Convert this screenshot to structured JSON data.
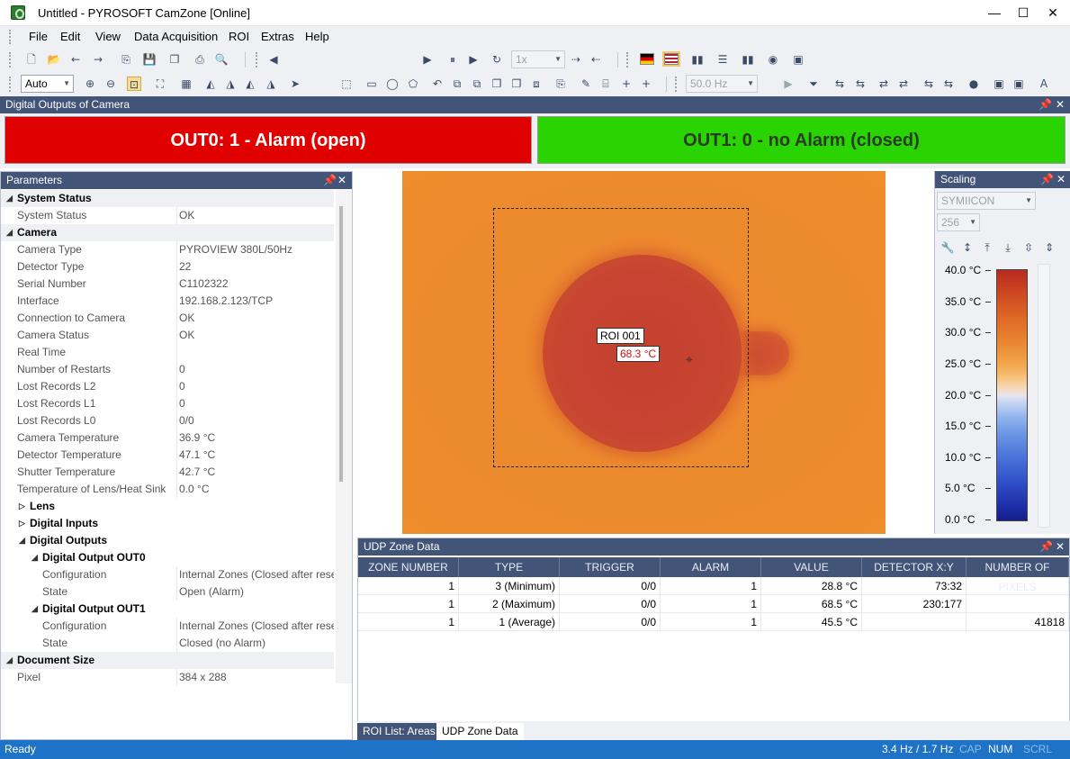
{
  "window": {
    "title": "Untitled - PYROSOFT CamZone [Online]",
    "minimize": "—",
    "maximize": "☐",
    "close": "✕"
  },
  "menu": [
    "File",
    "Edit",
    "View",
    "Data Acquisition",
    "ROI",
    "Extras",
    "Help"
  ],
  "toolbar": {
    "speed_combo": "1x",
    "zoom_combo": "Auto",
    "frequency_combo": "50.0 Hz"
  },
  "digital_outputs": {
    "title": "Digital Outputs of Camera",
    "out0": {
      "label": "OUT0: 1 - Alarm (open)",
      "color": "#e10000"
    },
    "out1": {
      "label": "OUT1: 0 - no Alarm (closed)",
      "color": "#2ad400"
    }
  },
  "parameters": {
    "title": "Parameters",
    "rows": [
      {
        "type": "cat",
        "name": "System Status"
      },
      {
        "type": "row",
        "name": "System Status",
        "value": "OK"
      },
      {
        "type": "cat",
        "name": "Camera"
      },
      {
        "type": "row",
        "name": "Camera Type",
        "value": "PYROVIEW 380L/50Hz"
      },
      {
        "type": "row",
        "name": "Detector Type",
        "value": "22"
      },
      {
        "type": "row",
        "name": "Serial Number",
        "value": "C1102322"
      },
      {
        "type": "row",
        "name": "Interface",
        "value": "192.168.2.123/TCP"
      },
      {
        "type": "row",
        "name": "Connection to Camera",
        "value": "OK"
      },
      {
        "type": "row",
        "name": "Camera Status",
        "value": "OK"
      },
      {
        "type": "row",
        "name": "Real Time",
        "value": ""
      },
      {
        "type": "row",
        "name": "Number of Restarts",
        "value": "0"
      },
      {
        "type": "row",
        "name": "Lost Records L2",
        "value": "0"
      },
      {
        "type": "row",
        "name": "Lost Records L1",
        "value": "0"
      },
      {
        "type": "row",
        "name": "Lost Records L0",
        "value": "0/0"
      },
      {
        "type": "row",
        "name": "Camera Temperature",
        "value": "36.9 °C"
      },
      {
        "type": "row",
        "name": "Detector Temperature",
        "value": "47.1 °C"
      },
      {
        "type": "row",
        "name": "Shutter Temperature",
        "value": "42.7 °C"
      },
      {
        "type": "row",
        "name": "Temperature of Lens/Heat Sink",
        "value": "0.0 °C"
      },
      {
        "type": "collapsed",
        "name": "Lens"
      },
      {
        "type": "collapsed",
        "name": "Digital Inputs"
      },
      {
        "type": "expanded",
        "name": "Digital Outputs"
      },
      {
        "type": "sub",
        "name": "Digital Output OUT0"
      },
      {
        "type": "subrow",
        "name": "Configuration",
        "value": "Internal Zones (Closed after reset)"
      },
      {
        "type": "subrow",
        "name": "State",
        "value": "Open (Alarm)"
      },
      {
        "type": "sub",
        "name": "Digital Output OUT1"
      },
      {
        "type": "subrow",
        "name": "Configuration",
        "value": "Internal Zones (Closed after reset)"
      },
      {
        "type": "subrow",
        "name": "State",
        "value": "Closed (no Alarm)"
      },
      {
        "type": "cat",
        "name": "Document Size"
      },
      {
        "type": "row",
        "name": "Pixel",
        "value": "384 x 288"
      }
    ]
  },
  "image": {
    "roi_label": "ROI 001",
    "roi_temp": "68.3 °C"
  },
  "scaling": {
    "title": "Scaling",
    "palette": "SYMIICON",
    "levels": "256",
    "ticks": [
      "40.0 °C",
      "35.0 °C",
      "30.0 °C",
      "25.0 °C",
      "20.0 °C",
      "15.0 °C",
      "10.0 °C",
      "5.0 °C",
      "0.0 °C"
    ]
  },
  "udp": {
    "title": "UDP Zone Data",
    "columns": [
      "ZONE NUMBER",
      "TYPE",
      "TRIGGER",
      "ALARM",
      "VALUE",
      "DETECTOR X:Y",
      "NUMBER OF PIXELS"
    ],
    "rows": [
      [
        "1",
        "3 (Minimum)",
        "0/0",
        "1",
        "28.8 °C",
        "73:32",
        ""
      ],
      [
        "1",
        "2 (Maximum)",
        "0/0",
        "1",
        "68.5 °C",
        "230:177",
        ""
      ],
      [
        "1",
        "1 (Average)",
        "0/0",
        "1",
        "45.5 °C",
        "",
        "41818"
      ]
    ]
  },
  "tabs": [
    "ROI List: Areas",
    "UDP Zone Data"
  ],
  "status": {
    "left": "Ready",
    "rate": "3.4 Hz / 1.7 Hz",
    "cap": "CAP",
    "num": "NUM",
    "scrl": "SCRL"
  }
}
